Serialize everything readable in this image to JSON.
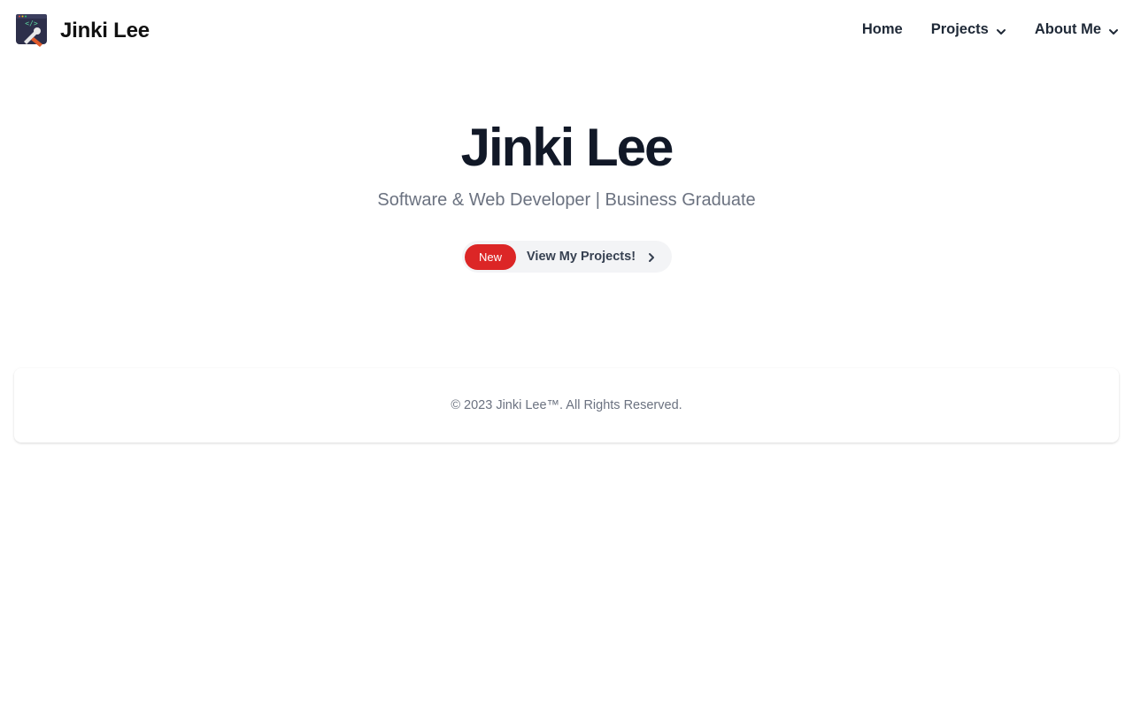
{
  "brand": {
    "name": "Jinki Lee",
    "logo_icon": "developer-tools-icon"
  },
  "nav": {
    "home": "Home",
    "projects": "Projects",
    "about": "About Me"
  },
  "hero": {
    "title": "Jinki Lee",
    "subtitle": "Software & Web Developer | Business Graduate"
  },
  "cta": {
    "badge": "New",
    "label": "View My Projects!"
  },
  "footer": {
    "text": "© 2023 Jinki Lee™. All Rights Reserved."
  },
  "colors": {
    "badge": "#dc2626",
    "title": "#111827",
    "muted": "#6b7280"
  }
}
